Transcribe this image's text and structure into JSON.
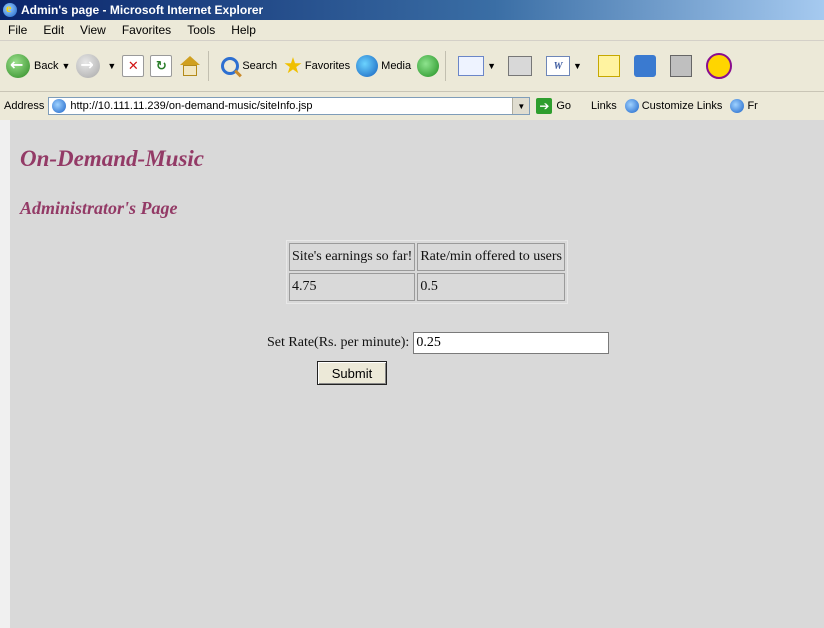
{
  "window": {
    "title": "Admin's page - Microsoft Internet Explorer"
  },
  "menu": [
    "File",
    "Edit",
    "View",
    "Favorites",
    "Tools",
    "Help"
  ],
  "toolbar": {
    "back": "Back",
    "search": "Search",
    "favorites": "Favorites",
    "media": "Media"
  },
  "address": {
    "label": "Address",
    "url": "http://10.111.11.239/on-demand-music/siteInfo.jsp",
    "go": "Go",
    "links": "Links",
    "customize_links": "Customize Links",
    "fr": "Fr"
  },
  "page": {
    "site_title": "On-Demand-Music",
    "page_title": "Administrator's Page",
    "table": {
      "headers": [
        "Site's earnings so far!",
        "Rate/min offered to users"
      ],
      "values": [
        "4.75",
        "0.5"
      ]
    },
    "rate_label": "Set Rate(Rs. per minute):",
    "rate_value": "0.25",
    "submit": "Submit"
  },
  "colors": {
    "heading": "#933a66",
    "content_bg": "#d9d9d9",
    "titlebar": "#0a246a"
  },
  "icons": [
    "ie-icon",
    "back-icon",
    "forward-icon",
    "stop-icon",
    "refresh-icon",
    "home-icon",
    "search-icon",
    "favorites-star-icon",
    "media-icon",
    "history-icon",
    "mail-icon",
    "print-icon",
    "word-icon",
    "notes-icon",
    "research-icon",
    "messenger-icon",
    "yahoo-icon",
    "go-arrow-icon"
  ]
}
